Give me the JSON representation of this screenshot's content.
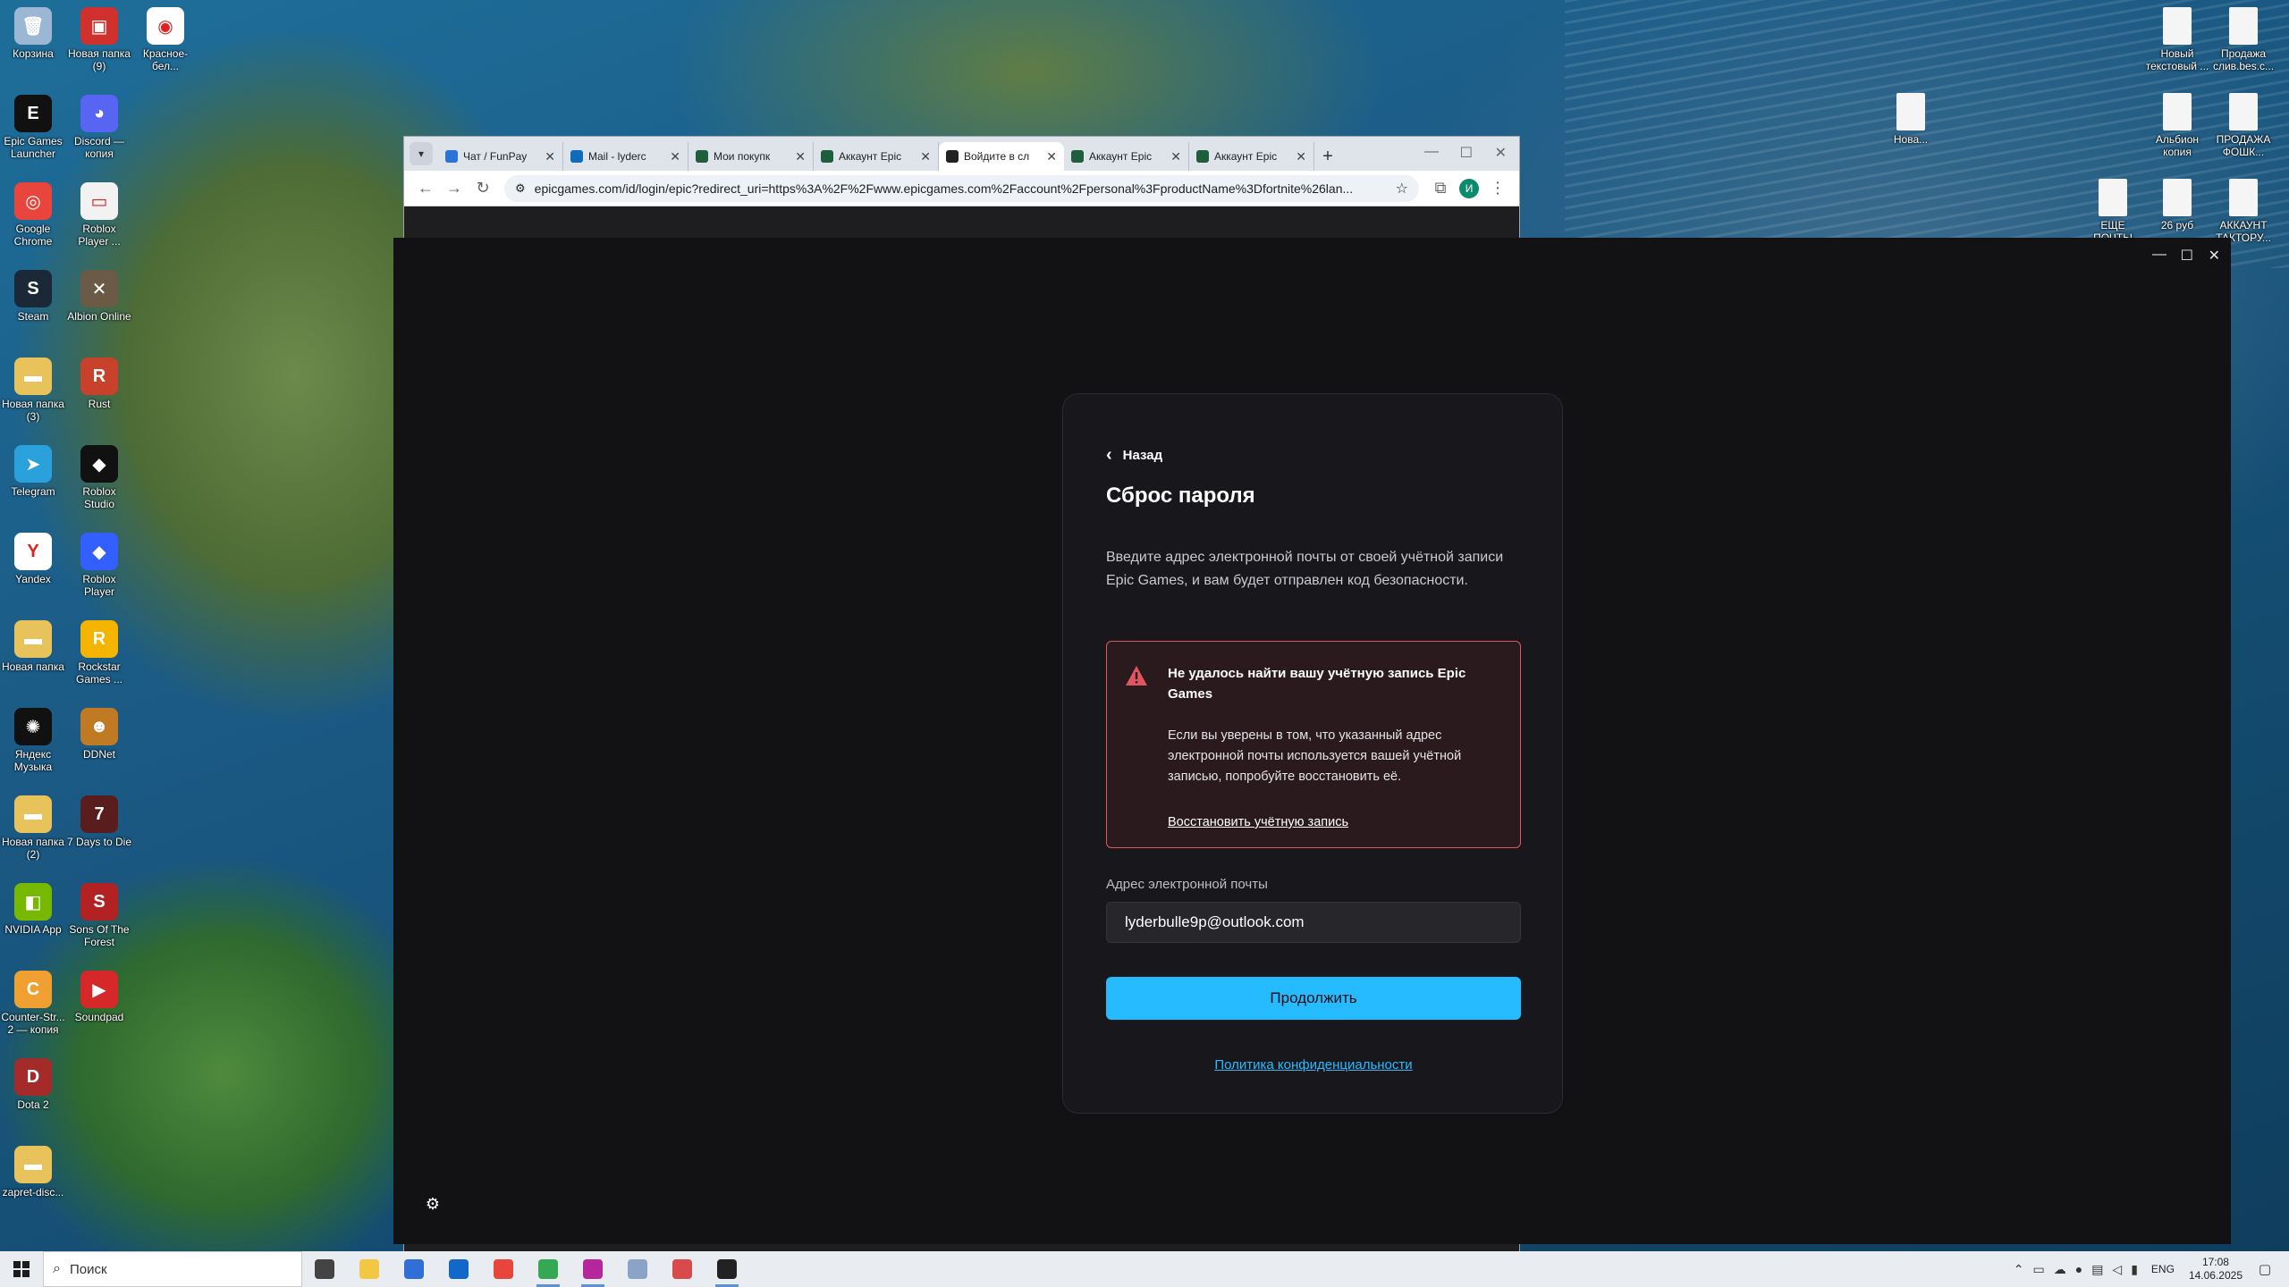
{
  "desktop": {
    "left_icons": [
      {
        "label": "Корзина",
        "color": "#9bb7d4",
        "glyph": "🗑"
      },
      {
        "label": "Новая папка (9)",
        "color": "#d0312d",
        "glyph": "▣"
      },
      {
        "label": "Красное-бел...",
        "color": "#ffffff",
        "glyph": "◉"
      },
      {
        "label": "Epic Games Launcher",
        "color": "#111111",
        "glyph": "E"
      },
      {
        "label": "Discord — копия",
        "color": "#5865f2",
        "glyph": "◕"
      },
      {
        "label": "Google Chrome",
        "color": "#e8453c",
        "glyph": "◎"
      },
      {
        "label": "Roblox Player ...",
        "color": "#f2f2f2",
        "glyph": "▭"
      },
      {
        "label": "Steam",
        "color": "#1b2838",
        "glyph": "S"
      },
      {
        "label": "Albion Online",
        "color": "#6b5a45",
        "glyph": "✕"
      },
      {
        "label": "Новая папка (3)",
        "color": "#e8c25a",
        "glyph": "▬"
      },
      {
        "label": "Rust",
        "color": "#c8412b",
        "glyph": "R"
      },
      {
        "label": "Telegram",
        "color": "#2aa1da",
        "glyph": "➤"
      },
      {
        "label": "Roblox Studio",
        "color": "#111111",
        "glyph": "◆"
      },
      {
        "label": "Yandex",
        "color": "#ffffff",
        "glyph": "Y"
      },
      {
        "label": "Roblox Player",
        "color": "#335fff",
        "glyph": "◆"
      },
      {
        "label": "Новая папка",
        "color": "#e8c25a",
        "glyph": "▬"
      },
      {
        "label": "Rockstar Games ...",
        "color": "#f5b400",
        "glyph": "R"
      },
      {
        "label": "Яндекс Музыка",
        "color": "#111111",
        "glyph": "✺"
      },
      {
        "label": "DDNet",
        "color": "#c07a24",
        "glyph": "☻"
      },
      {
        "label": "Новая папка (2)",
        "color": "#e8c25a",
        "glyph": "▬"
      },
      {
        "label": "7 Days to Die",
        "color": "#5a1d1d",
        "glyph": "7"
      },
      {
        "label": "NVIDIA App",
        "color": "#76b900",
        "glyph": "◧"
      },
      {
        "label": "Sons Of The Forest",
        "color": "#b22222",
        "glyph": "S"
      },
      {
        "label": "Counter-Str... 2 — копия",
        "color": "#f0a030",
        "glyph": "C"
      },
      {
        "label": "Soundpad",
        "color": "#d62828",
        "glyph": "▶"
      },
      {
        "label": "Dota 2",
        "color": "#a52a2a",
        "glyph": "D"
      },
      {
        "label": "zapret-disc...",
        "color": "#e8c25a",
        "glyph": "▬"
      }
    ],
    "right_icons": [
      {
        "label": "Новый текстовый ...",
        "color": "#f5f5f5"
      },
      {
        "label": "Продажа слив.bes.c...",
        "color": "#f5f5f5"
      },
      {
        "label": "Нова...",
        "color": "#f5f5f5"
      },
      {
        "label": "Альбион копия",
        "color": "#f5f5f5"
      },
      {
        "label": "ПРОДАЖА ФОШК...",
        "color": "#f5f5f5"
      },
      {
        "label": "ЕЩЕ ПОЧТЫ",
        "color": "#f5f5f5"
      },
      {
        "label": "26 руб",
        "color": "#f5f5f5"
      },
      {
        "label": "АККАУНТ ТАКТОРУ...",
        "color": "#f5f5f5"
      }
    ]
  },
  "browser": {
    "tabs": [
      {
        "title": "Чат / FunPay",
        "fav_color": "#2b74d6",
        "active": false
      },
      {
        "title": "Mail - lyderc",
        "fav_color": "#0f6cbd",
        "active": false
      },
      {
        "title": "Мои покупк",
        "fav_color": "#1f5e3c",
        "active": false
      },
      {
        "title": "Аккаунт Epic",
        "fav_color": "#1f5e3c",
        "active": false
      },
      {
        "title": "Войдите в сл",
        "fav_color": "#222222",
        "active": true
      },
      {
        "title": "Аккаунт Epic",
        "fav_color": "#1f5e3c",
        "active": false
      },
      {
        "title": "Аккаунт Epic",
        "fav_color": "#1f5e3c",
        "active": false
      }
    ],
    "url": "epicgames.com/id/login/epic?redirect_uri=https%3A%2F%2Fwww.epicgames.com%2Faccount%2Fpersonal%3FproductName%3Dfortnite%26lan...",
    "profile_initial": "И"
  },
  "reset": {
    "back_label": "Назад",
    "title": "Сброс пароля",
    "description": "Введите адрес электронной почты от своей учётной записи Epic Games, и вам будет отправлен код безопасности.",
    "error": {
      "title": "Не удалось найти вашу учётную запись Epic Games",
      "body": "Если вы уверены в том, что указанный адрес электронной почты используется вашей учётной записью, попробуйте восстановить её.",
      "link": "Восстановить учётную запись",
      "color": "#e0555f"
    },
    "email_label": "Адрес электронной почты",
    "email_value": "lyderbulle9p@outlook.com",
    "continue_label": "Продолжить",
    "privacy_label": "Политика конфиденциальности",
    "accent": "#26bbff"
  },
  "taskbar": {
    "search_placeholder": "Поиск",
    "apps": [
      {
        "name": "task-view",
        "color": "#444444",
        "running": false
      },
      {
        "name": "file-explorer",
        "color": "#f2c744",
        "running": false
      },
      {
        "name": "ms-store",
        "color": "#2f6fd6",
        "running": false
      },
      {
        "name": "outlook",
        "color": "#1168c6",
        "running": false
      },
      {
        "name": "yandex-browser",
        "color": "#e8453c",
        "running": false
      },
      {
        "name": "chrome",
        "color": "#34a853",
        "running": true
      },
      {
        "name": "opera-gx",
        "color": "#b5279b",
        "running": true
      },
      {
        "name": "app",
        "color": "#8ba3c7",
        "running": false
      },
      {
        "name": "app-2",
        "color": "#d94a4a",
        "running": false
      },
      {
        "name": "epic-games",
        "color": "#222222",
        "running": true
      }
    ],
    "lang": "ENG",
    "time": "17:08",
    "date": "14.06.2025"
  }
}
